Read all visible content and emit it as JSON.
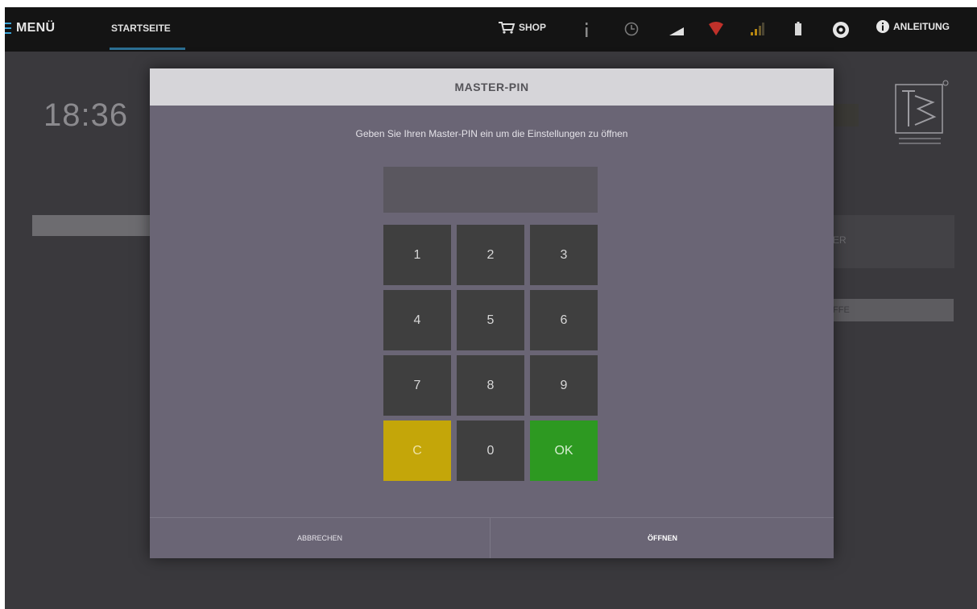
{
  "topbar": {
    "menu_label": "MENÜ",
    "tab_home_label": "STARTSEITE",
    "shop_label": "SHOP",
    "help_label": "ANLEITUNG",
    "status_icons": [
      "info-icon",
      "clock-icon",
      "signal-strength-icon",
      "wifi-icon",
      "cellular-icon",
      "battery-icon",
      "settings-circle-icon"
    ],
    "colors": {
      "accent": "#2b6f93",
      "wifi": "#c0312a",
      "cellular": "#b8870f"
    }
  },
  "background": {
    "clock": "18:36",
    "card_partial": "ER",
    "strip_partial": "FFE"
  },
  "dialog": {
    "title": "MASTER-PIN",
    "message": "Geben Sie Ihren Master-PIN ein um die Einstellungen zu öffnen",
    "pin_value": "",
    "keys": [
      "1",
      "2",
      "3",
      "4",
      "5",
      "6",
      "7",
      "8",
      "9",
      "C",
      "0",
      "OK"
    ],
    "cancel_label": "ABBRECHEN",
    "open_label": "ÖFFNEN",
    "colors": {
      "clear_key": "#c4a609",
      "ok_key": "#2d9921",
      "key": "#3f3f3f"
    }
  }
}
